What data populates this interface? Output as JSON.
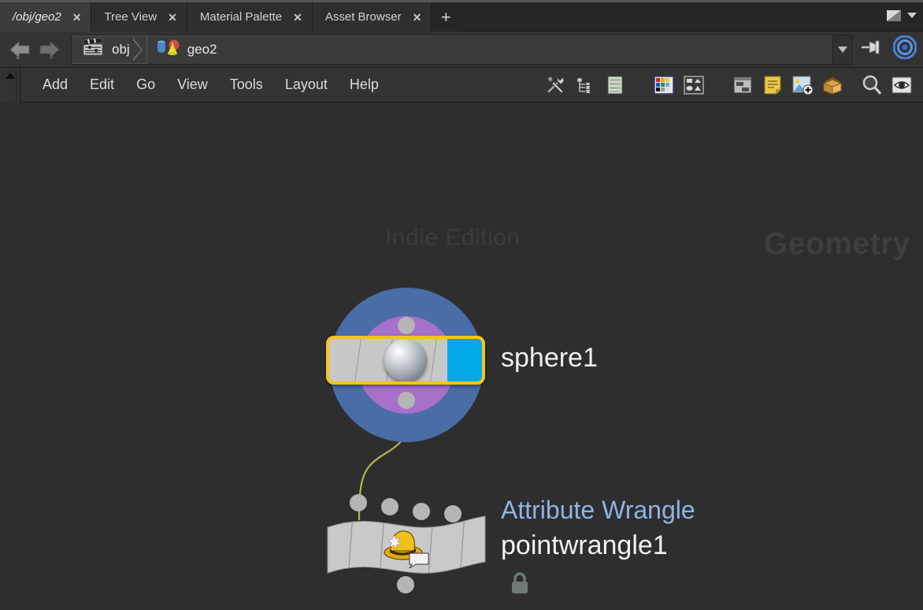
{
  "window": {
    "restore_icon": "restore-window-icon",
    "menu_arrow_icon": "chevron-down-icon"
  },
  "tabbar": {
    "tabs": [
      {
        "label": "/obj/geo2",
        "active": true,
        "close_icon": "close-icon"
      },
      {
        "label": "Tree View",
        "active": false,
        "close_icon": "close-icon"
      },
      {
        "label": "Material Palette",
        "active": false,
        "close_icon": "close-icon"
      },
      {
        "label": "Asset Browser",
        "active": false,
        "close_icon": "close-icon"
      }
    ],
    "new_tab_label": "+"
  },
  "pathbar": {
    "back_icon": "back-arrow-icon",
    "forward_icon": "forward-arrow-icon",
    "crumbs": [
      {
        "label": "obj",
        "icon": "clapperboard-icon"
      },
      {
        "label": "geo2",
        "icon": "geometry-primitives-icon"
      }
    ],
    "dropdown_icon": "chevron-down-icon",
    "pin_icon": "pin-icon",
    "target_icon": "target-circles-icon"
  },
  "menubar": {
    "scroll_up_icon": "scroll-up-icon",
    "menus": [
      {
        "label": "Add"
      },
      {
        "label": "Edit"
      },
      {
        "label": "Go"
      },
      {
        "label": "View"
      },
      {
        "label": "Tools"
      },
      {
        "label": "Layout"
      },
      {
        "label": "Help"
      }
    ],
    "tools": [
      {
        "icon": "wrench-screwdriver-icon"
      },
      {
        "icon": "tree-hierarchy-icon"
      },
      {
        "icon": "list-sheet-icon"
      },
      {
        "icon": "color-palette-icon"
      },
      {
        "icon": "shapes-grid-icon"
      },
      {
        "icon": "panel-layout-icon"
      },
      {
        "icon": "sticky-note-icon"
      },
      {
        "icon": "add-image-icon"
      },
      {
        "icon": "open-box-icon"
      },
      {
        "icon": "magnifier-icon"
      },
      {
        "icon": "eye-icon"
      }
    ]
  },
  "network": {
    "watermark_edition": "Indie Edition",
    "watermark_context": "Geometry",
    "nodes": [
      {
        "name": "sphere1",
        "type_label": "",
        "selected": true,
        "display_flag": true,
        "glyph": "sphere-glyph",
        "inputs": 1,
        "outputs": 1
      },
      {
        "name": "pointwrangle1",
        "type_label": "Attribute Wrangle",
        "selected": false,
        "display_flag": false,
        "glyph": "wrangle-hat-icon",
        "locked_icon": "lock-icon",
        "inputs": 4,
        "outputs": 1
      }
    ],
    "connections": [
      {
        "from": "sphere1",
        "to": "pointwrangle1",
        "color": "#b5b54a"
      }
    ]
  },
  "colors": {
    "selection_ring_outer": "#4a6da7",
    "selection_ring_inner": "#a670cb",
    "selected_outline": "#f5c518",
    "display_flag": "#00a8e8",
    "node_body": "#c8c8c8",
    "wire": "#b5b54a",
    "type_label": "#8fb4e8",
    "background": "#2e2e2e"
  }
}
